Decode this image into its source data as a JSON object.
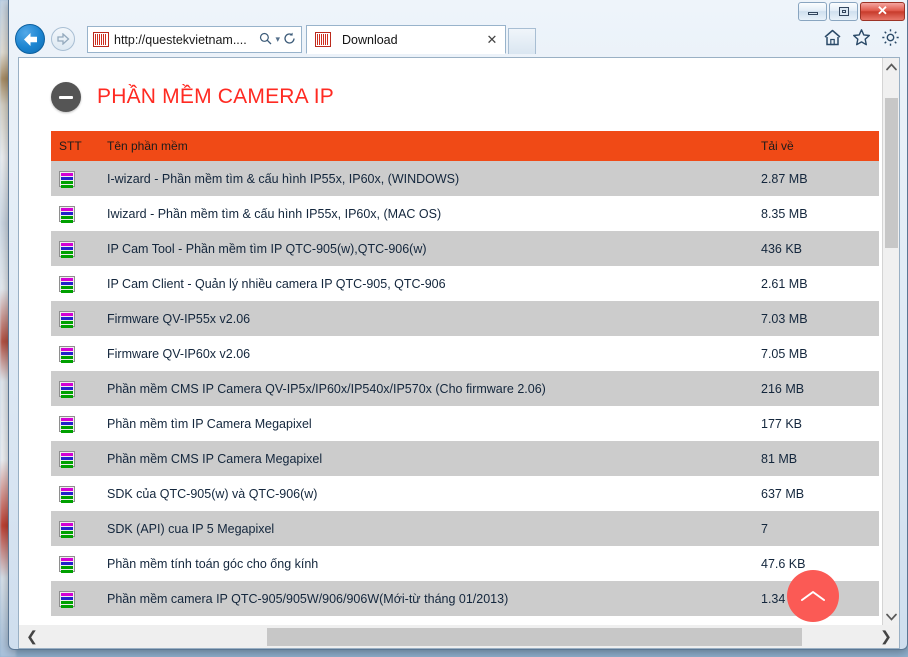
{
  "window": {
    "controls": {
      "minimize": "minimize-button",
      "restore": "restore-button",
      "close_label": "✕"
    }
  },
  "browser": {
    "back_label": "←",
    "forward_label": "→",
    "address": {
      "url": "http://questekvietnam....",
      "placeholder": "http://",
      "search_glyph": "⌕",
      "caret_glyph": "▾",
      "refresh_glyph": "↻"
    },
    "tab": {
      "title": "Download",
      "close_label": "✕"
    },
    "tools": {
      "home": "⌂",
      "favorites": "★",
      "settings": "⚙"
    }
  },
  "page": {
    "title": "PHẦN MỀM CAMERA IP",
    "accent_color": "#ff2a22",
    "header_bar_color": "#f04a16",
    "row_alt_color": "#cccccc",
    "scroll_top_color": "#fb5a55",
    "scroll_top_glyph": "⌃",
    "table": {
      "columns": [
        "STT",
        "Tên phần mềm",
        "Tải về"
      ],
      "rows": [
        {
          "icon": "archive-icon",
          "name": "I-wizard - Phần mềm tìm & cấu hình IP55x, IP60x, (WINDOWS)",
          "size": "2.87 MB"
        },
        {
          "icon": "archive-icon",
          "name": "Iwizard - Phần mềm tìm & cấu hình IP55x, IP60x, (MAC OS)",
          "size": "8.35 MB"
        },
        {
          "icon": "archive-icon",
          "name": "IP Cam Tool - Phần mềm tìm IP QTC-905(w),QTC-906(w)",
          "size": "436 KB"
        },
        {
          "icon": "archive-icon",
          "name": "IP Cam Client - Quản lý nhiều camera IP QTC-905, QTC-906",
          "size": "2.61 MB"
        },
        {
          "icon": "archive-icon",
          "name": "Firmware QV-IP55x v2.06",
          "size": "7.03 MB"
        },
        {
          "icon": "archive-icon",
          "name": "Firmware QV-IP60x v2.06",
          "size": "7.05 MB"
        },
        {
          "icon": "archive-icon",
          "name": "Phần mềm CMS IP Camera QV-IP5x/IP60x/IP540x/IP570x (Cho firmware 2.06)",
          "size": "216 MB"
        },
        {
          "icon": "archive-icon",
          "name": "Phần mềm tìm IP Camera Megapixel",
          "size": "177 KB"
        },
        {
          "icon": "archive-icon",
          "name": "Phần mềm CMS IP Camera Megapixel",
          "size": "81 MB"
        },
        {
          "icon": "archive-icon",
          "name": "SDK của QTC-905(w) và QTC-906(w)",
          "size": "637 MB"
        },
        {
          "icon": "archive-icon",
          "name": "SDK (API) cua IP 5 Megapixel",
          "size": "7"
        },
        {
          "icon": "archive-icon",
          "name": "Phần mềm tính toán góc cho ống kính",
          "size": "47.6 KB"
        },
        {
          "icon": "archive-icon",
          "name": "Phần mềm camera IP QTC-905/905W/906/906W(Mới-từ tháng 01/2013)",
          "size": "1.34 MB"
        }
      ]
    }
  },
  "scrollbars": {
    "vertical": {
      "up": "⌃",
      "down": "⌄"
    },
    "horizontal": {
      "left": "❮",
      "right": "❯"
    }
  }
}
